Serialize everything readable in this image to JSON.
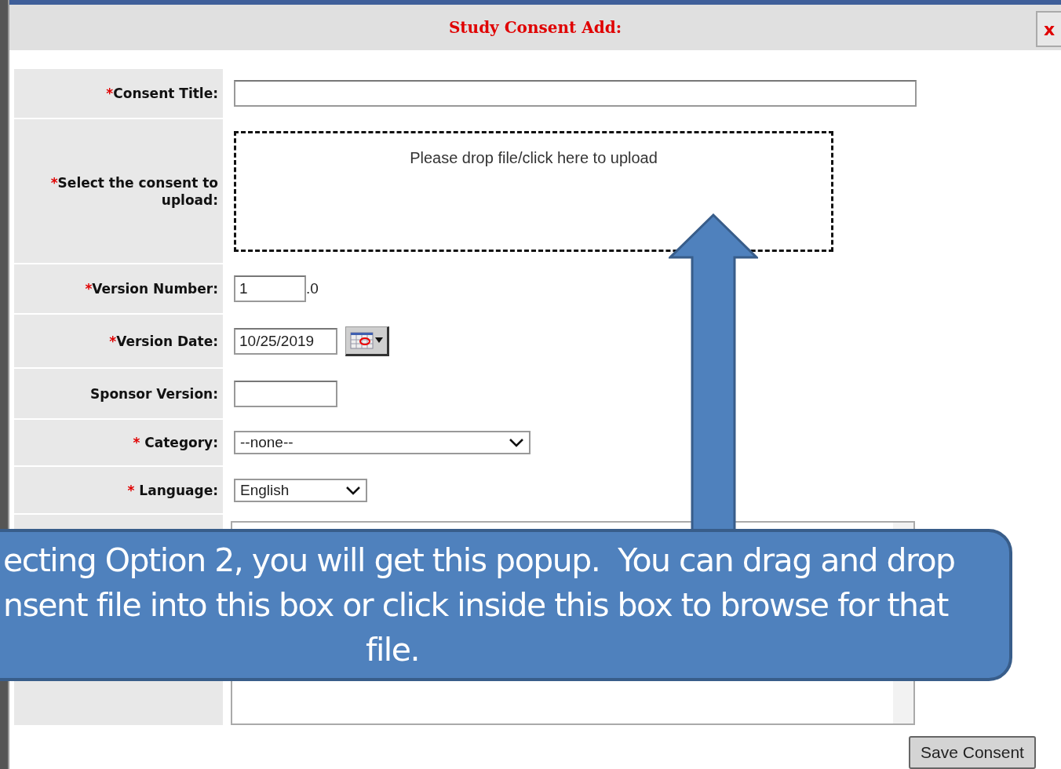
{
  "dialog": {
    "title": "Study Consent Add:",
    "close_label": "x"
  },
  "fields": [
    {
      "kind": "text",
      "marker": "*",
      "label": "Consent Title:"
    },
    {
      "kind": "dropzone",
      "marker": "*",
      "label": "Select the consent to upload:",
      "placeholder": "Please drop file/click here to upload"
    },
    {
      "kind": "version",
      "marker": "*",
      "label": "Version Number:",
      "value": "1",
      "suffix": ".0"
    },
    {
      "kind": "date",
      "marker": "*",
      "label": "Version Date:",
      "value": "10/25/2019"
    },
    {
      "kind": "short",
      "label": "Sponsor Version:"
    },
    {
      "kind": "select",
      "marker": "* ",
      "label": "Category:",
      "value": "--none--"
    },
    {
      "kind": "select-short",
      "marker": "* ",
      "label": "Language:",
      "value": "English"
    },
    {
      "kind": "textarea"
    }
  ],
  "save_button": "Save Consent",
  "callout": {
    "lines": [
      "ecting Option 2, you will get this popup.  You can drag and drop",
      "nsent file into this box or click inside this box to browse for that",
      "file."
    ]
  }
}
